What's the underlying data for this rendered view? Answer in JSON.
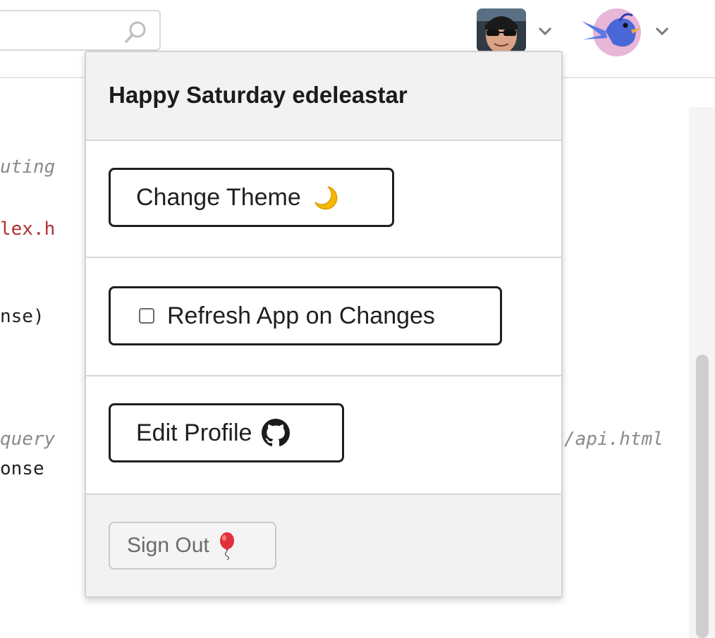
{
  "header": {
    "search": {
      "placeholder": ""
    },
    "user_avatar": {
      "icon": "user-avatar-icon"
    },
    "bot_avatar": {
      "icon": "bird-avatar-icon"
    }
  },
  "editor": {
    "lines": [
      {
        "text": "uting",
        "style": "comment"
      },
      {
        "text": "lex.h",
        "style": "string"
      },
      {
        "text": "nse)",
        "style": "plain"
      },
      {
        "text": "query",
        "style": "comment"
      },
      {
        "text": "onse",
        "style": "plain"
      },
      {
        "text": "/api.html",
        "style": "comment"
      }
    ]
  },
  "menu": {
    "greeting": "Happy Saturday edeleastar",
    "change_theme": {
      "label": "Change Theme",
      "icon": "moon-icon"
    },
    "refresh": {
      "label": "Refresh App on Changes",
      "checked": false
    },
    "edit_profile": {
      "label": "Edit Profile",
      "icon": "github-icon"
    },
    "sign_out": {
      "label": "Sign Out",
      "icon": "balloon-icon"
    }
  },
  "colors": {
    "accent_moon": "#f5b800",
    "balloon": "#e0313b",
    "bird_body": "#4a67d8",
    "bird_bg": "#e8b6d8"
  }
}
